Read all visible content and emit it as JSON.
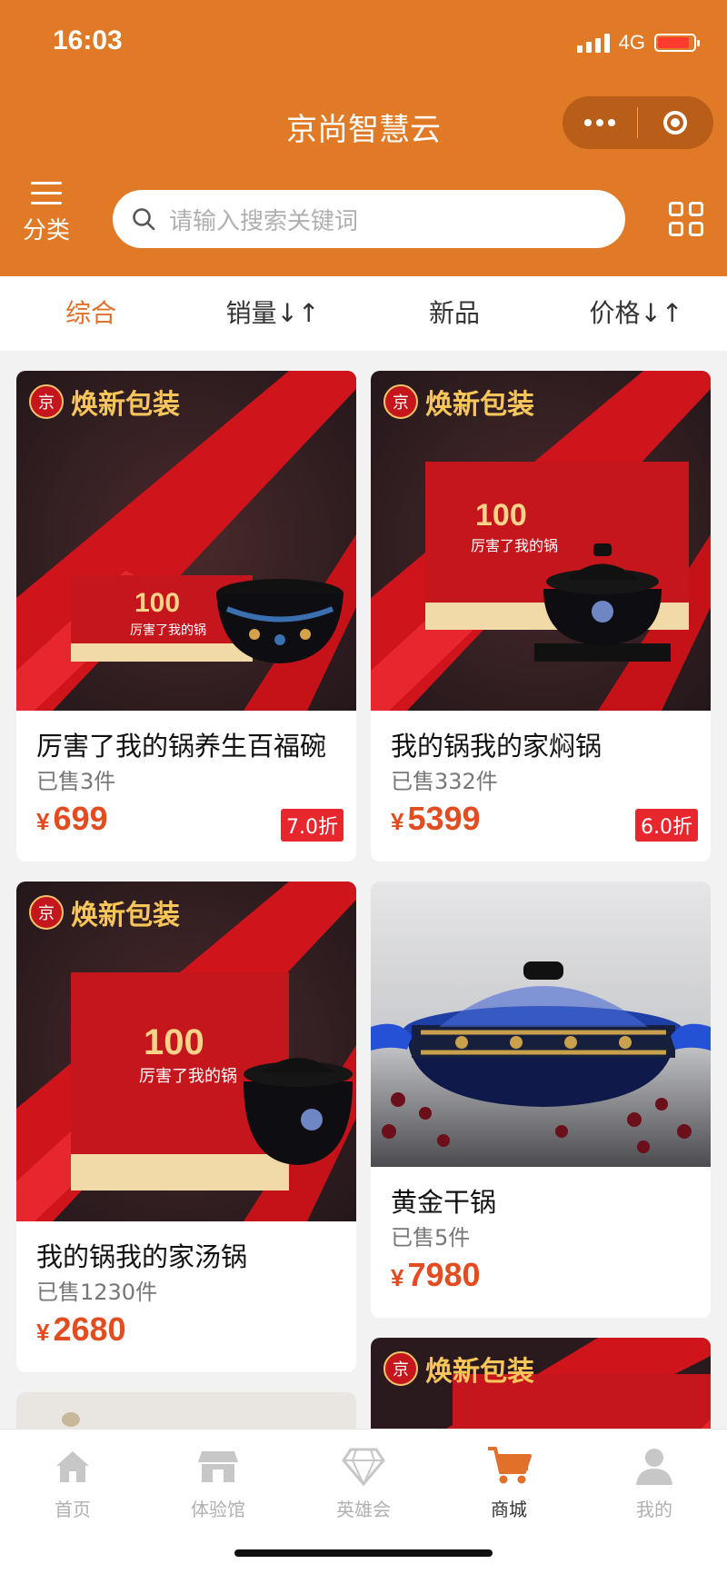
{
  "status": {
    "time": "16:03",
    "network": "4G",
    "battery_level": 0.9
  },
  "app": {
    "title": "京尚智慧云"
  },
  "header": {
    "category_label": "分类",
    "search_placeholder": "请输入搜索关键词"
  },
  "sort": {
    "tabs": [
      "综合",
      "销量↓↑",
      "新品",
      "价格↓↑"
    ],
    "active": 0
  },
  "badge_text": "焕新包装",
  "badge_logo": "京",
  "products": [
    {
      "name": "厉害了我的锅养生百福碗",
      "sold": "已售3件",
      "currency": "¥",
      "price": "699",
      "discount": "7.0折",
      "box_text": "100",
      "box_sub": "厉害了我的锅"
    },
    {
      "name": "我的锅我的家焖锅",
      "sold": "已售332件",
      "currency": "¥",
      "price": "5399",
      "discount": "6.0折",
      "box_text": "100",
      "box_sub": "厉害了我的锅"
    },
    {
      "name": "我的锅我的家汤锅",
      "sold": "已售1230件",
      "currency": "¥",
      "price": "2680",
      "box_text": "100",
      "box_sub": "厉害了我的锅"
    },
    {
      "name": "黄金干锅",
      "sold": "已售5件",
      "currency": "¥",
      "price": "7980"
    }
  ],
  "tabbar": [
    {
      "label": "首页",
      "icon": "home-icon"
    },
    {
      "label": "体验馆",
      "icon": "store-icon"
    },
    {
      "label": "英雄会",
      "icon": "diamond-icon"
    },
    {
      "label": "商城",
      "icon": "cart-icon"
    },
    {
      "label": "我的",
      "icon": "user-icon"
    }
  ],
  "colors": {
    "header": "#e07a26",
    "price": "#e24c21",
    "discount": "#e8262d",
    "active_sort": "#e0702a"
  }
}
